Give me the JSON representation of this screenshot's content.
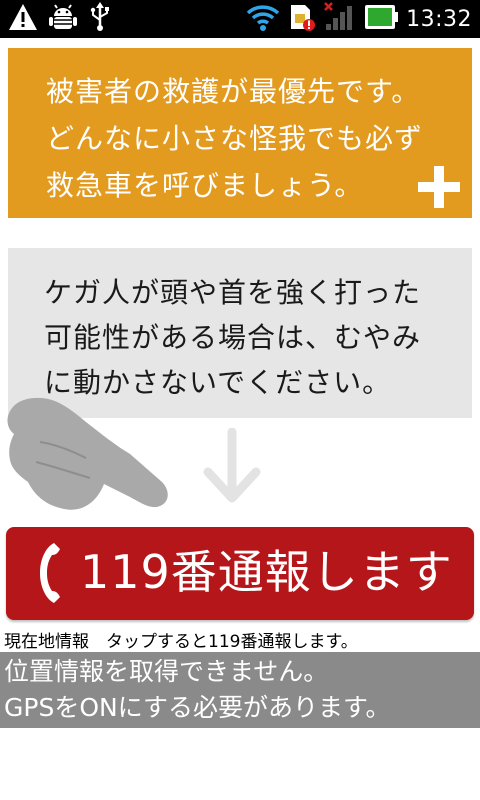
{
  "status_bar": {
    "time": "13:32",
    "left_icons": [
      "warning-icon",
      "android-debug-icon",
      "usb-icon"
    ],
    "right_icons": [
      "wifi-icon",
      "sim-alert-icon",
      "signal-icon",
      "battery-icon"
    ],
    "battery_color": "#2ea82e"
  },
  "cards": {
    "priority_text": "被害者の救護が最優先です。\nどんなに小さな怪我でも必ず\n救急車を呼びましょう。",
    "warning_text": "ケガ人が頭や首を強く打った\n可能性がある場合は、むやみ\nに動かさないでください。"
  },
  "call_button": {
    "label": "119番通報します"
  },
  "location": {
    "label": "現在地情報　タップすると119番通報します。",
    "message_line1": "位置情報を取得できません。",
    "message_line2": "GPSをONにする必要があります。"
  },
  "colors": {
    "orange": "#e39b1f",
    "grey_card": "#e6e6e6",
    "call_red": "#b5161a",
    "gps_grey": "#8a8a8a"
  }
}
